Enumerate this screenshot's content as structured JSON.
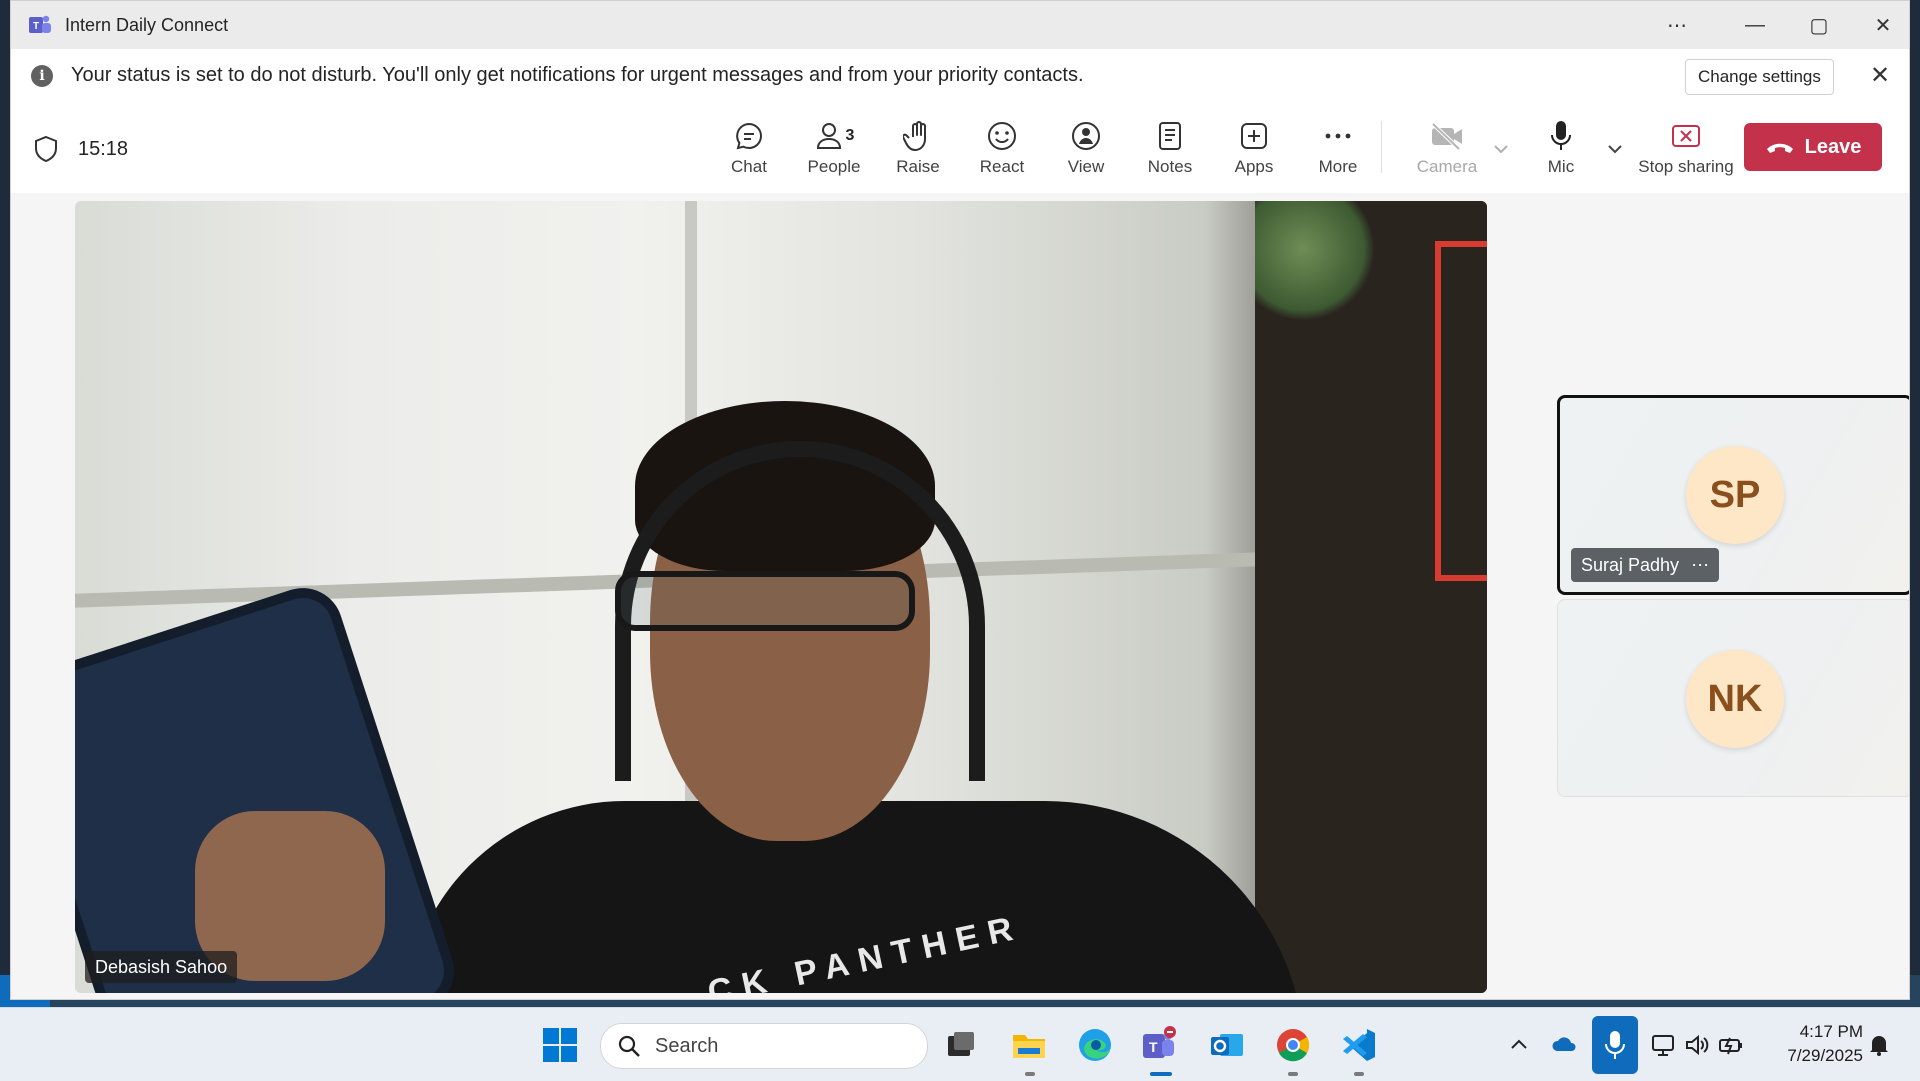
{
  "window": {
    "title": "Intern Daily Connect",
    "controls": {
      "more": "⋯",
      "minimize": "—",
      "maximize": "▢",
      "close": "✕"
    }
  },
  "banner": {
    "message": "Your status is set to do not disturb. You'll only get notifications for urgent messages and from your priority contacts.",
    "change_settings": "Change settings",
    "close": "✕"
  },
  "meeting": {
    "elapsed": "15:18",
    "toolbar": {
      "chat": "Chat",
      "people": "People",
      "people_count": "3",
      "raise": "Raise",
      "react": "React",
      "view": "View",
      "notes": "Notes",
      "apps": "Apps",
      "more": "More",
      "camera": "Camera",
      "mic": "Mic",
      "stop_sharing": "Stop sharing",
      "leave": "Leave"
    },
    "main_video": {
      "name": "Debasish Sahoo",
      "shirt_text": "CK PANTHER"
    },
    "participants": [
      {
        "initials": "SP",
        "name": "Suraj Padhy",
        "more": "⋯"
      },
      {
        "initials": "NK"
      }
    ]
  },
  "taskbar": {
    "search_placeholder": "Search",
    "time": "4:17 PM",
    "date": "7/29/2025"
  },
  "colors": {
    "accent_purple": "#5b5fc7",
    "leave_red": "#c4314b",
    "taskbar_blue": "#0f6cbd"
  },
  "icons": [
    "teams-icon",
    "info-icon",
    "shield-icon",
    "chat-icon",
    "people-icon",
    "raise-hand-icon",
    "react-icon",
    "view-icon",
    "notes-icon",
    "apps-icon",
    "more-icon",
    "camera-off-icon",
    "mic-icon",
    "stop-sharing-icon",
    "phone-icon",
    "windows-start-icon",
    "search-icon",
    "file-explorer-icon",
    "edge-icon",
    "outlook-icon",
    "chrome-icon",
    "vscode-icon",
    "onedrive-icon",
    "network-icon",
    "volume-icon",
    "battery-icon",
    "notification-icon"
  ]
}
